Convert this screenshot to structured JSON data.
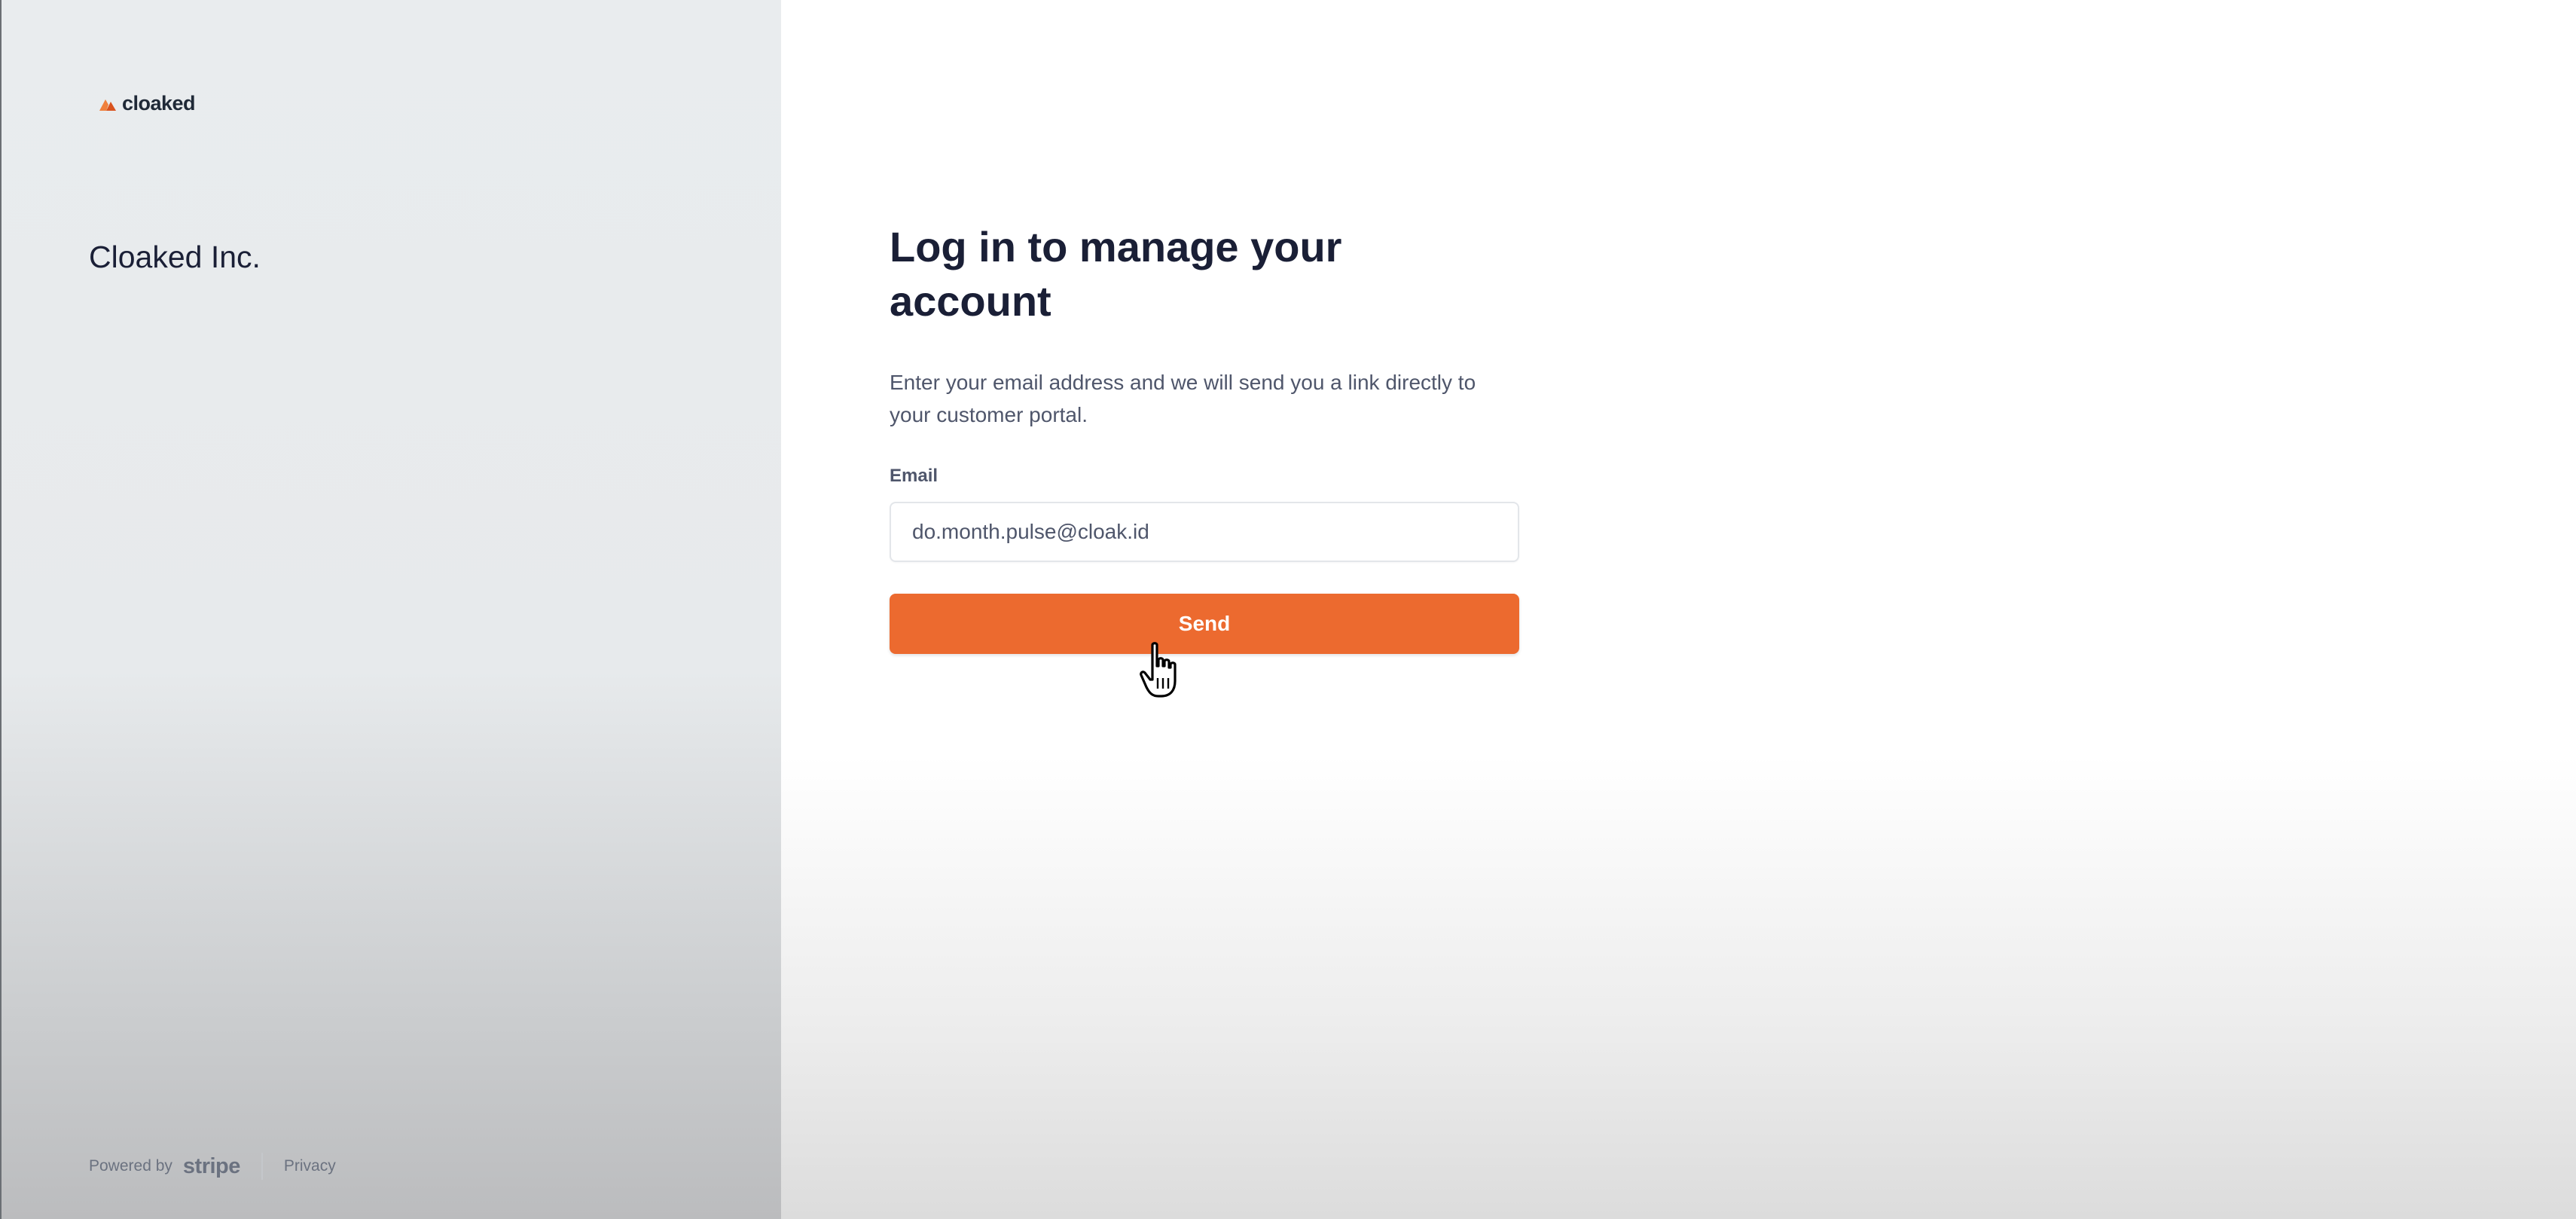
{
  "brand": {
    "logo_text": "cloaked",
    "logo_icon": "cloaked-logo-icon",
    "company_name": "Cloaked Inc."
  },
  "footer": {
    "powered_by": "Powered by",
    "stripe": "stripe",
    "privacy": "Privacy"
  },
  "form": {
    "title": "Log in to manage your account",
    "subtitle": "Enter your email address and we will send you a link directly to your customer portal.",
    "email_label": "Email",
    "email_value": "do.month.pulse@cloak.id",
    "send_label": "Send"
  },
  "colors": {
    "accent": "#ec6a2f",
    "text_dark": "#1a1f36",
    "text_muted": "#4f566b"
  },
  "cursor": {
    "icon": "hand-pointer-icon"
  }
}
